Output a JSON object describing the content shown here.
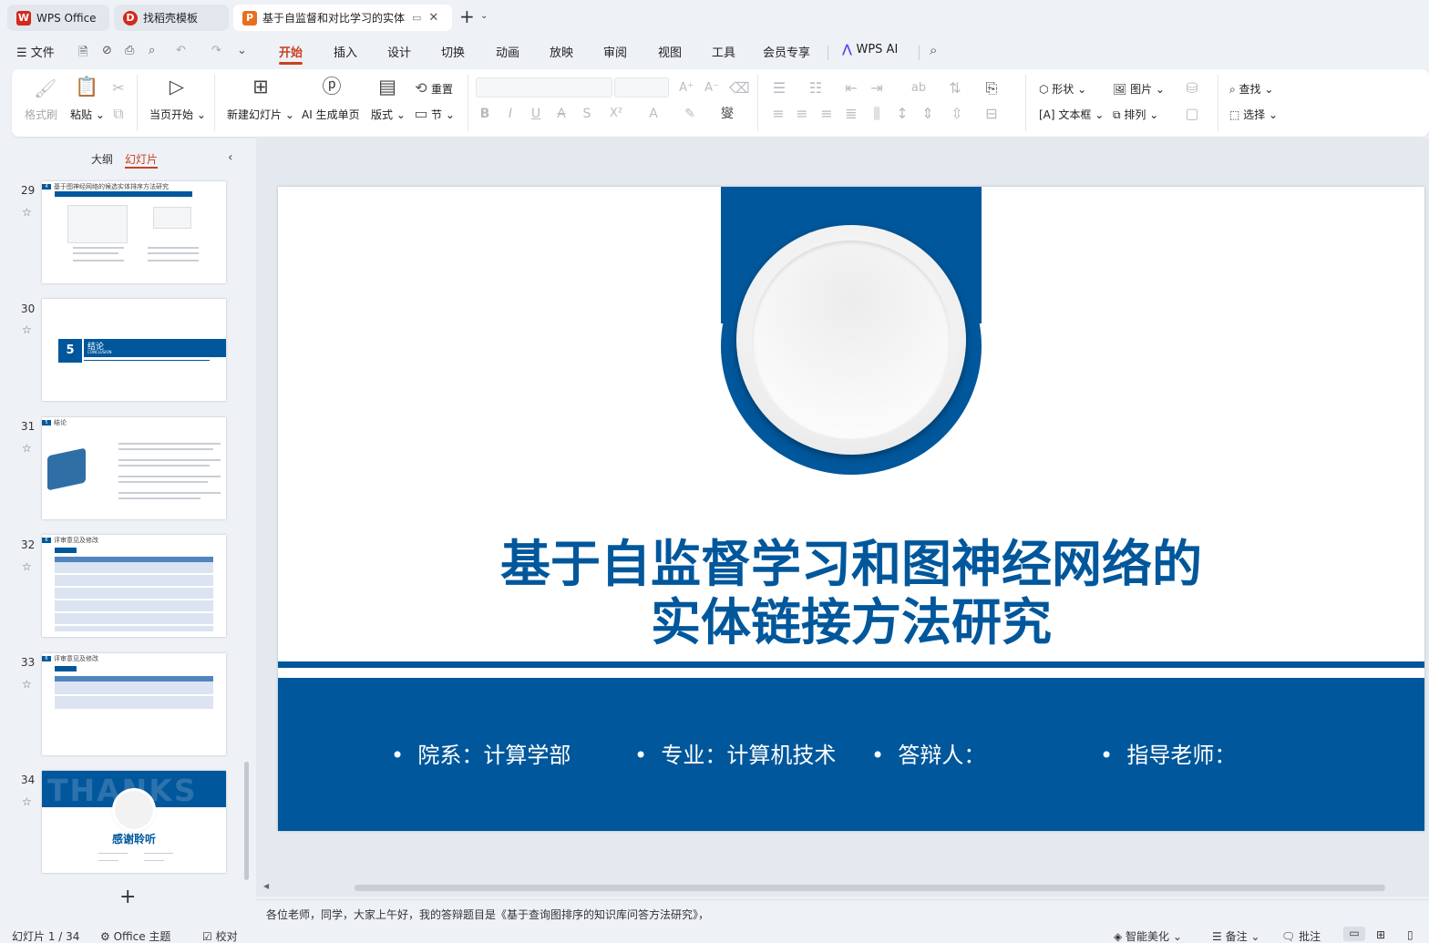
{
  "tabs": [
    {
      "label": "WPS Office",
      "icon": "wps-logo-icon"
    },
    {
      "label": "找稻壳模板",
      "icon": "docer-icon"
    },
    {
      "label": "基于自监督和对比学习的实体",
      "icon": "presentation-icon",
      "active": true
    }
  ],
  "menu": {
    "file_label": "文件",
    "items": [
      "开始",
      "插入",
      "设计",
      "切换",
      "动画",
      "放映",
      "审阅",
      "视图",
      "工具",
      "会员专享"
    ],
    "active": "开始",
    "ai_label": "WPS AI"
  },
  "ribbon": {
    "format_painter": "格式刷",
    "paste": "粘贴",
    "from_current": "当页开始",
    "new_slide": "新建幻灯片",
    "ai_single": "AI 生成单页",
    "layout": "版式",
    "reset": "重置",
    "section": "节",
    "shape": "形状",
    "picture": "图片",
    "textbox": "文本框",
    "arrange": "排列",
    "find": "查找",
    "select": "选择"
  },
  "panel": {
    "outline_tab": "大纲",
    "slides_tab": "幻灯片",
    "thumbnails": [
      {
        "num": "29",
        "title": "基于图神经网络的候选实体排序方法研究",
        "badge": "4"
      },
      {
        "num": "30",
        "title": "结论",
        "sub": "CONCLUSION",
        "badge": "5"
      },
      {
        "num": "31",
        "title": "结论",
        "badge": "5"
      },
      {
        "num": "32",
        "title": "评审意见及修改",
        "badge": "6"
      },
      {
        "num": "33",
        "title": "评审意见及修改",
        "badge": "6"
      },
      {
        "num": "34",
        "title": "感谢聆听",
        "bg_word": "THANKS"
      }
    ]
  },
  "slide": {
    "title_line1": "基于自监督学习和图神经网络的",
    "title_line2": "实体链接方法研究",
    "info": [
      "院系：计算学部",
      "专业：计算机技术",
      "答辩人：",
      "指导老师："
    ]
  },
  "notes": "各位老师，同学，大家上午好，我的答辩题目是《基于查询图排序的知识库问答方法研究》，",
  "status": {
    "slide_count": "幻灯片 1 / 34",
    "theme": "Office 主题",
    "proof": "校对",
    "beautify": "智能美化",
    "notes_btn": "备注",
    "comments_btn": "批注"
  },
  "colors": {
    "accent": "#c8421e",
    "slide_blue": "#00579b",
    "wps_red": "#d2291c"
  }
}
